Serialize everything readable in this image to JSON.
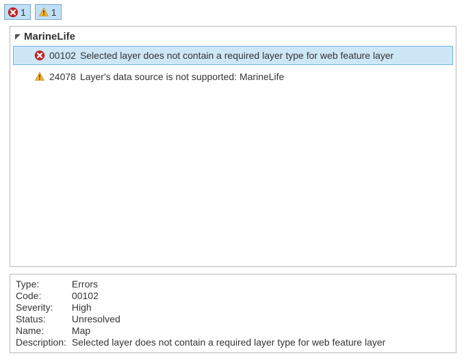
{
  "filters": {
    "errors": {
      "count": "1",
      "icon": "error-icon"
    },
    "warnings": {
      "count": "1",
      "icon": "warning-icon"
    }
  },
  "group": {
    "name": "MarineLife"
  },
  "items": [
    {
      "severity": "error",
      "code": "00102",
      "message": "Selected layer does not contain a required layer type for web feature layer",
      "selected": true
    },
    {
      "severity": "warning",
      "code": "24078",
      "message": "Layer's data source is not supported: MarineLife",
      "selected": false
    }
  ],
  "details": {
    "labels": {
      "type": "Type:",
      "code": "Code:",
      "severity": "Severity:",
      "status": "Status:",
      "name": "Name:",
      "description": "Description:"
    },
    "values": {
      "type": "Errors",
      "code": "00102",
      "severity": "High",
      "status": "Unresolved",
      "name": "Map",
      "description": "Selected layer does not contain a required layer type for web feature layer"
    }
  }
}
